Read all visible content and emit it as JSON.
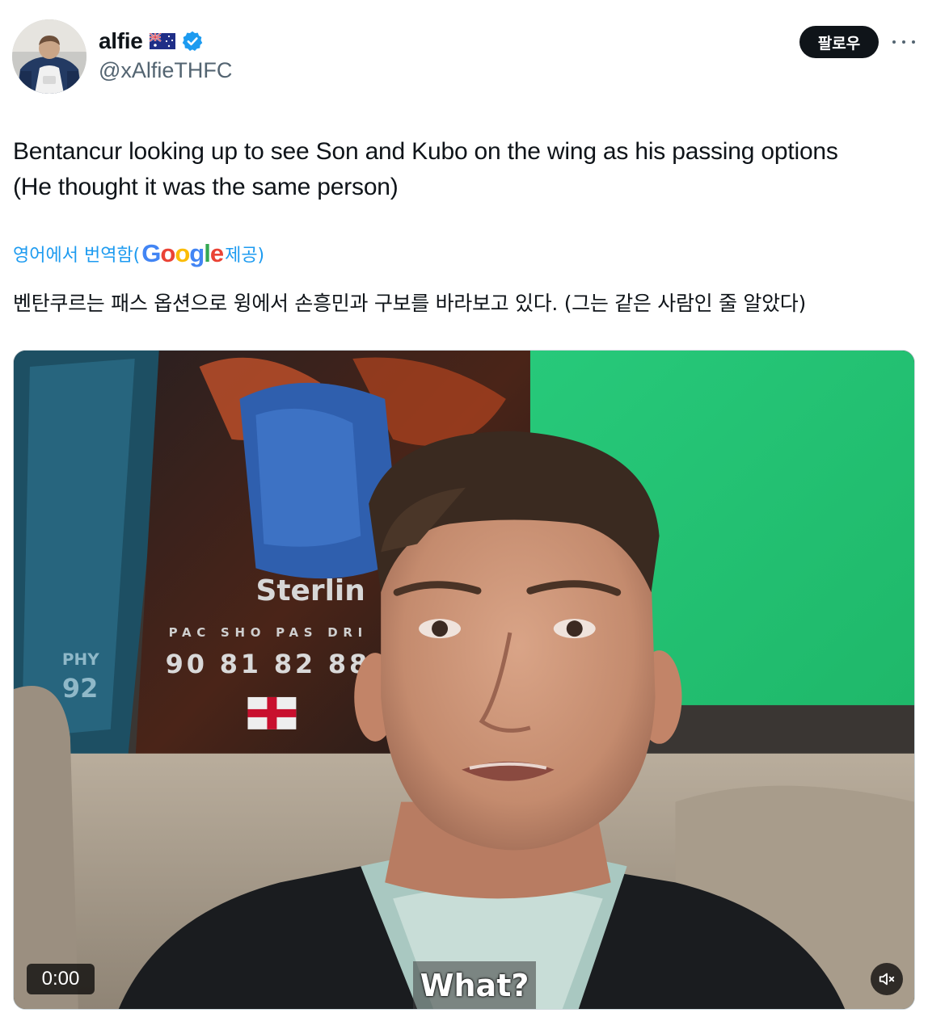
{
  "author": {
    "display_name": "alfie",
    "handle": "@xAlfieTHFC",
    "flag_icon": "australia-flag-icon",
    "verified_icon": "verified-badge-icon",
    "verified_color": "#1d9bf0"
  },
  "actions": {
    "follow_label": "팔로우",
    "more_icon": "more-horizontal-icon"
  },
  "tweet": {
    "text": "Bentancur looking up to see Son and Kubo on the wing as his passing options (He thought it was the same person)"
  },
  "translation": {
    "prefix": "영어에서 번역함(",
    "provider": "Google",
    "suffix": " 제공)",
    "text": "벤탄쿠르는 패스 옵션으로 윙에서 손흥민과 구보를 바라보고 있다. (그는 같은 사람인 줄 알았다)"
  },
  "media": {
    "type": "video",
    "subtitle": "What?",
    "time": "0:00",
    "card_name": "Sterlin",
    "card_stats_labels": "PAC SHO PAS DRI",
    "card_stats_values": "90 81 82 88",
    "card_side_label": "PHY",
    "card_side_value": "92",
    "mute_icon": "volume-muted-icon"
  },
  "colors": {
    "link": "#1d9bf0",
    "secondary_text": "#536471",
    "follow_bg": "#0f1419"
  }
}
